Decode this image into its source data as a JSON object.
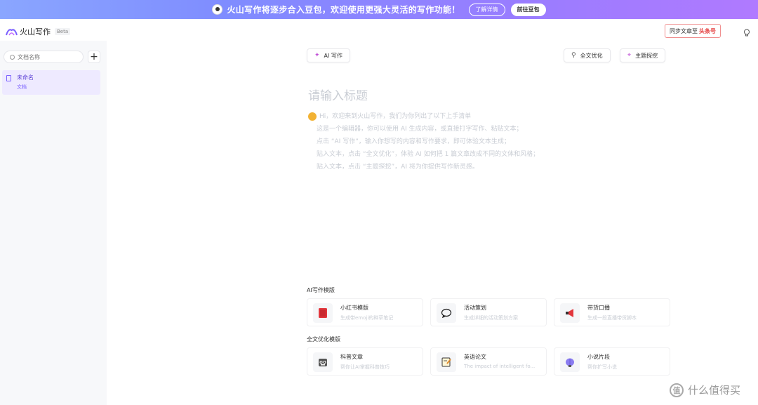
{
  "banner": {
    "text": "火山写作将逐步合入豆包，欢迎使用更强大灵活的写作功能！",
    "learn_more": "了解详情",
    "go_doubao": "前往豆包"
  },
  "header": {
    "app_name": "火山写作",
    "badge": "Beta",
    "sync_label": "同步文章至",
    "sync_target": "头条号"
  },
  "sidebar": {
    "search_placeholder": "文档名称",
    "add_label": "+",
    "docs": [
      {
        "title": "未命名",
        "subtitle": "文档"
      }
    ]
  },
  "toolbar": {
    "ai_write": "AI 写作",
    "optimize": "全文优化",
    "topic": "主题探挖"
  },
  "editor": {
    "title_placeholder": "请输入标题",
    "hint_lines": [
      "Hi，欢迎来到火山写作，我们为你列出了以下上手清单",
      "这是一个编辑器，你可以使用 AI 生成内容，或直接打字写作、粘贴文本；",
      "点击 “AI 写作”，输入你想写的内容和写作要求，即可体验文本生成；",
      "贴入文本，点击 “全文优化”，体验 AI 如何把 1 篇文章改成不同的文体和风格；",
      "贴入文本，点击 “主题探挖”，AI 将为你提供写作新灵感。"
    ]
  },
  "templates": {
    "ai_section": "AI写作模版",
    "ai_cards": [
      {
        "title": "小红书模版",
        "desc": "生成带emoji的种草笔记",
        "icon": "red-book-icon"
      },
      {
        "title": "活动策划",
        "desc": "生成详细的活动策划方案",
        "icon": "chat-bubble-icon"
      },
      {
        "title": "带货口播",
        "desc": "生成一段直播带货脚本",
        "icon": "megaphone-icon"
      }
    ],
    "opt_section": "全文优化模版",
    "opt_cards": [
      {
        "title": "科普文章",
        "desc": "帮你让AI掌握科普技巧",
        "icon": "robot-icon"
      },
      {
        "title": "英语论文",
        "desc": "The impact of intelligent fo...",
        "icon": "notepad-icon"
      },
      {
        "title": "小说片段",
        "desc": "帮你扩写小说",
        "icon": "brain-icon"
      }
    ]
  },
  "watermark": {
    "text": "什么值得买",
    "glyph": "值"
  }
}
